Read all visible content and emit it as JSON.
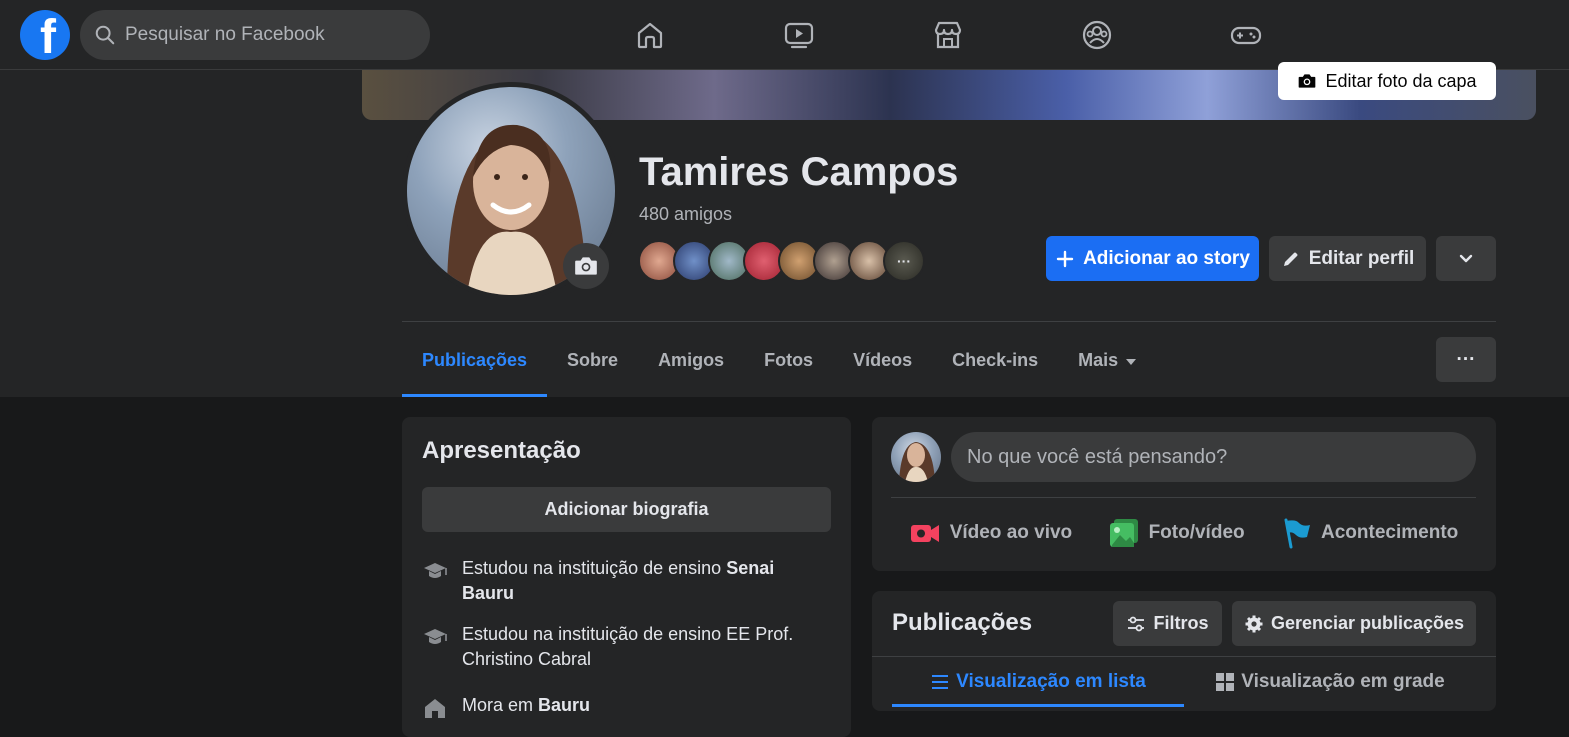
{
  "topbar": {
    "search_placeholder": "Pesquisar no Facebook",
    "logo_letter": "f",
    "nav_icons": [
      "home-icon",
      "watch-icon",
      "marketplace-icon",
      "groups-icon",
      "gaming-icon"
    ]
  },
  "cover": {
    "edit_button_label": "Editar foto da capa"
  },
  "profile": {
    "name": "Tamires Campos",
    "friends_count": "480 amigos",
    "more_friends_label": "···"
  },
  "actions": {
    "add_story_label": "Adicionar ao story",
    "edit_profile_label": "Editar perfil"
  },
  "tabs": [
    {
      "label": "Publicações",
      "active": true
    },
    {
      "label": "Sobre"
    },
    {
      "label": "Amigos"
    },
    {
      "label": "Fotos"
    },
    {
      "label": "Vídeos"
    },
    {
      "label": "Check-ins"
    },
    {
      "label": "Mais"
    }
  ],
  "tab_more_button": "···",
  "intro": {
    "title": "Apresentação",
    "add_bio_label": "Adicionar biografia",
    "items": [
      {
        "prefix": "Estudou na instituição de ensino ",
        "bold": "Senai Bauru"
      },
      {
        "prefix": "Estudou na instituição de ensino EE Prof. Christino Cabral",
        "bold": ""
      },
      {
        "prefix": "Mora em ",
        "bold": "Bauru"
      }
    ]
  },
  "composer": {
    "placeholder": "No que você está pensando?",
    "live_label": "Vídeo ao vivo",
    "photo_label": "Foto/vídeo",
    "event_label": "Acontecimento"
  },
  "posts": {
    "title": "Publicações",
    "filters_label": "Filtros",
    "manage_label": "Gerenciar publicações",
    "list_view_label": "Visualização em lista",
    "grid_view_label": "Visualização em grade"
  },
  "colors": {
    "accent": "#2d88ff",
    "primary_button": "#1b6ef3",
    "background": "#18191a",
    "surface": "#242526",
    "secondary_button": "#3a3b3c",
    "live_red": "#f3425f",
    "photo_green": "#45bd62",
    "event_blue": "#1b9bd1"
  }
}
